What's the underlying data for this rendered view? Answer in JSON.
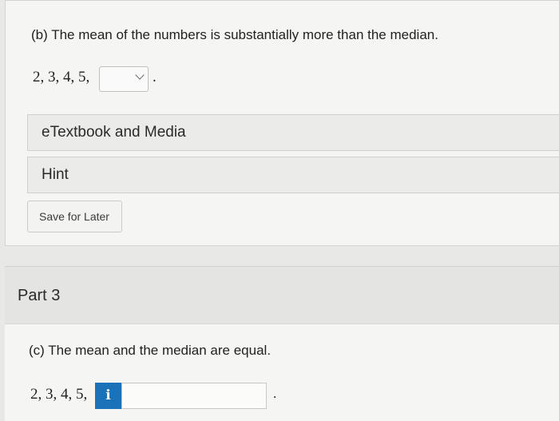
{
  "part_b": {
    "question": "(b) The mean of the numbers is substantially more than the median.",
    "sequence": "2, 3, 4, 5,",
    "dropdown_value": "",
    "trailing_period": "."
  },
  "resources": {
    "etextbook_label": "eTextbook and Media",
    "hint_label": "Hint",
    "save_later_label": "Save for Later"
  },
  "part_3": {
    "title": "Part 3",
    "question": "(c) The mean and the median are equal.",
    "sequence": "2, 3, 4, 5,",
    "info_label": "i",
    "input_value": "",
    "trailing_period": "."
  },
  "icons": {
    "dropdown": "chevron-down-icon",
    "info": "info-icon"
  },
  "colors": {
    "info_button": "#1a73b8"
  }
}
